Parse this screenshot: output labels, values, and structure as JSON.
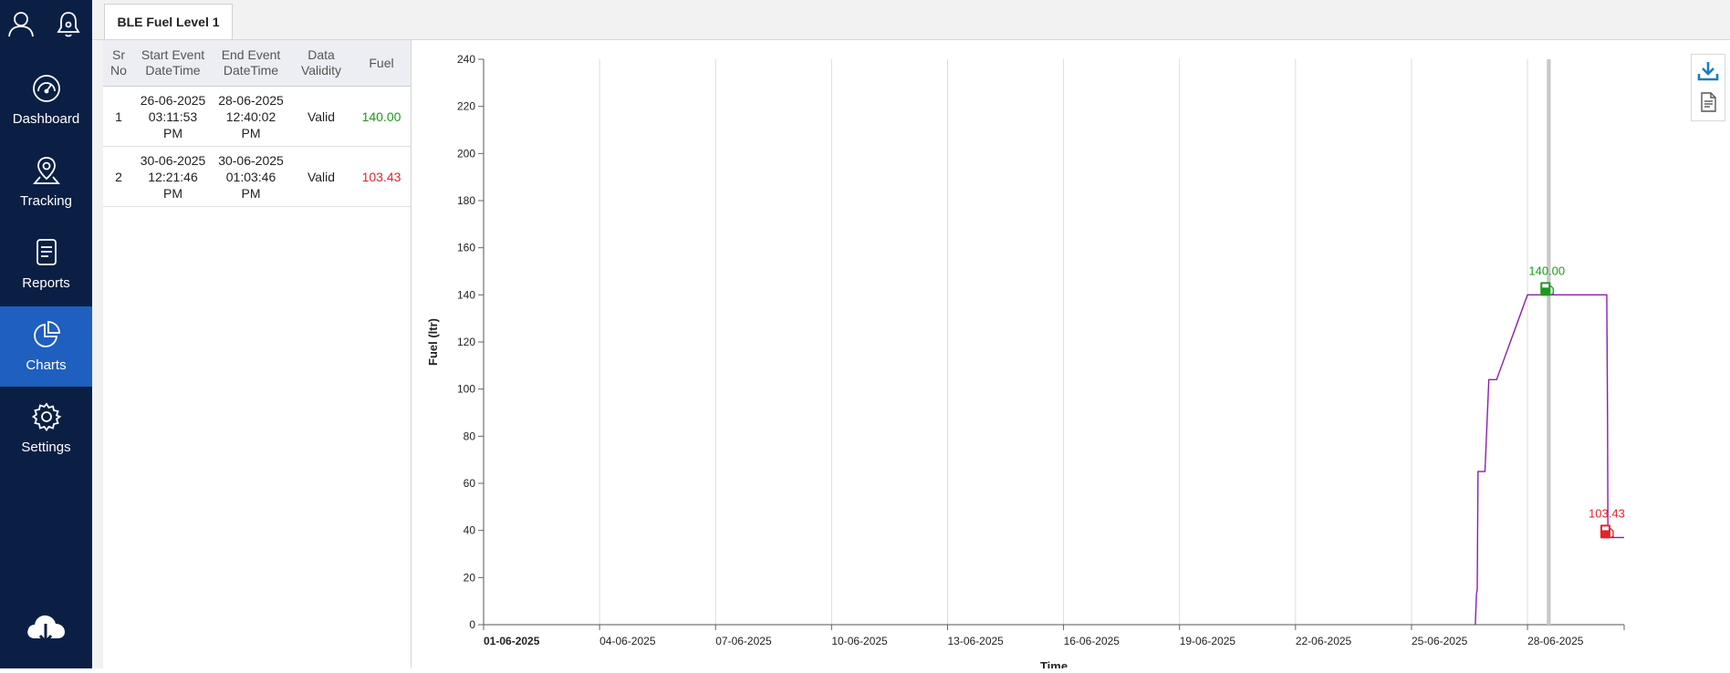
{
  "sidebar": {
    "top_icons": [
      "user-icon",
      "bell-icon"
    ],
    "items": [
      {
        "label": "Dashboard",
        "icon": "speedometer-icon"
      },
      {
        "label": "Tracking",
        "icon": "map-pin-icon"
      },
      {
        "label": "Reports",
        "icon": "document-icon"
      },
      {
        "label": "Charts",
        "icon": "pie-chart-icon",
        "active": true
      },
      {
        "label": "Settings",
        "icon": "gear-icon"
      }
    ],
    "bottom_icon": "cloud-download-icon",
    "colors": {
      "background": "#0b1f44",
      "active": "#1f5fbf"
    }
  },
  "tabs": [
    {
      "label": "BLE Fuel Level 1"
    }
  ],
  "table": {
    "headers": {
      "sr_no": "Sr No",
      "start": "Start Event DateTime",
      "end": "End Event DateTime",
      "validity": "Data Validity",
      "fuel": "Fuel"
    },
    "rows": [
      {
        "sr": "1",
        "start_date": "26-06-2025",
        "start_time": "03:11:53",
        "start_ampm": "PM",
        "end_date": "28-06-2025",
        "end_time": "12:40:02",
        "end_ampm": "PM",
        "validity": "Valid",
        "fuel": "140.00",
        "fuel_color": "#1a9a1a"
      },
      {
        "sr": "2",
        "start_date": "30-06-2025",
        "start_time": "12:21:46",
        "start_ampm": "PM",
        "end_date": "30-06-2025",
        "end_time": "01:03:46",
        "end_ampm": "PM",
        "validity": "Valid",
        "fuel": "103.43",
        "fuel_color": "#e3242b"
      }
    ]
  },
  "toolbar": {
    "icons": [
      "download-icon",
      "document-icon"
    ]
  },
  "chart_data": {
    "type": "line",
    "xlabel": "Time",
    "ylabel": "Fuel (ltr)",
    "ylim": [
      0,
      240
    ],
    "yticks": [
      0,
      20,
      40,
      60,
      80,
      100,
      120,
      140,
      160,
      180,
      200,
      220,
      240
    ],
    "xlim_days": [
      1,
      30.5
    ],
    "xticks": [
      "01-06-2025",
      "04-06-2025",
      "07-06-2025",
      "10-06-2025",
      "13-06-2025",
      "16-06-2025",
      "19-06-2025",
      "22-06-2025",
      "25-06-2025",
      "28-06-2025"
    ],
    "grid": true,
    "series": [
      {
        "color": "#8a1fa8",
        "points": [
          [
            26.65,
            0
          ],
          [
            26.68,
            13
          ],
          [
            26.7,
            15
          ],
          [
            26.72,
            65
          ],
          [
            26.9,
            65
          ],
          [
            27.0,
            104
          ],
          [
            27.2,
            104
          ],
          [
            28.0,
            140
          ],
          [
            29.3,
            140
          ],
          [
            30.05,
            140
          ],
          [
            30.07,
            88
          ],
          [
            30.08,
            40
          ],
          [
            30.12,
            37
          ],
          [
            30.5,
            37
          ]
        ]
      }
    ],
    "highlight_band": [
      28.5,
      28.6
    ],
    "events": [
      {
        "label": "140.00",
        "day": 28.5,
        "value": 140,
        "color": "#1a9a1a",
        "kind": "refuel"
      },
      {
        "label": "103.43",
        "day": 30.05,
        "value": 37,
        "color": "#e3242b",
        "kind": "drain"
      }
    ]
  }
}
